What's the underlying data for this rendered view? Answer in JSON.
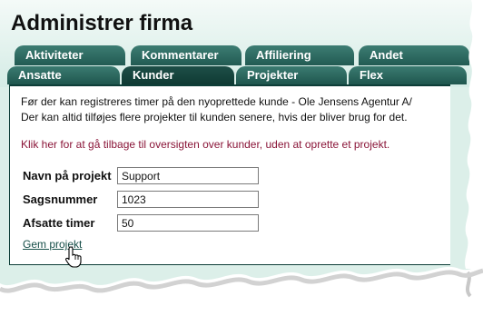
{
  "page_title": "Administrer firma",
  "tabs_row1": [
    {
      "label": "Aktiviteter"
    },
    {
      "label": "Kommentarer"
    },
    {
      "label": "Affiliering"
    },
    {
      "label": "Andet"
    }
  ],
  "tabs_row2": [
    {
      "label": "Ansatte"
    },
    {
      "label": "Kunder"
    },
    {
      "label": "Projekter"
    },
    {
      "label": "Flex"
    }
  ],
  "active_tab": "Kunder",
  "info_line1": "Før der kan registreres timer på den nyoprettede kunde - Ole Jensens Agentur A/",
  "info_line2": "Der kan altid tilføjes flere projekter til kunden senere, hvis der bliver brug for det.",
  "back_link": "Klik her for at gå tilbage til oversigten over kunder, uden at oprette et projekt.",
  "form": {
    "project_name_label": "Navn på projekt",
    "project_name_value": "Support",
    "case_number_label": "Sagsnummer",
    "case_number_value": "1023",
    "hours_label": "Afsatte timer",
    "hours_value": "50"
  },
  "save_link": "Gem projekt",
  "colors": {
    "tab_dark": "#225b53",
    "tab_active": "#0f3a34",
    "link_maroon": "#8a1538",
    "panel_bg": "#dcefe9"
  }
}
